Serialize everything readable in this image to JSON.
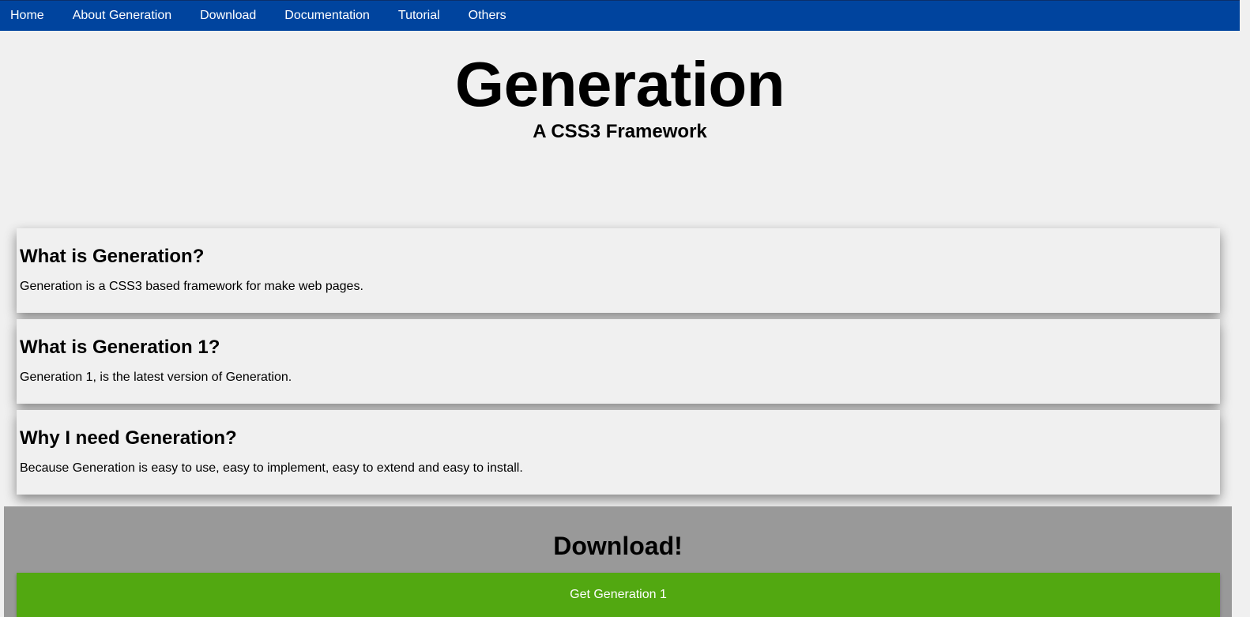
{
  "nav": {
    "items": [
      {
        "label": "Home"
      },
      {
        "label": "About Generation"
      },
      {
        "label": "Download"
      },
      {
        "label": "Documentation"
      },
      {
        "label": "Tutorial"
      },
      {
        "label": "Others"
      }
    ]
  },
  "hero": {
    "title": "Generation",
    "subtitle": "A CSS3 Framework"
  },
  "cards": [
    {
      "title": "What is Generation?",
      "text": "Generation is a CSS3 based framework for make web pages."
    },
    {
      "title": "What is Generation 1?",
      "text": "Generation 1, is the latest version of Generation."
    },
    {
      "title": "Why I need Generation?",
      "text": "Because Generation is easy to use, easy to implement, easy to extend and easy to install."
    }
  ],
  "download": {
    "title": "Download!",
    "button_label": "Get Generation 1"
  },
  "colors": {
    "nav_bg": "#00449e",
    "page_bg": "#f0f0f0",
    "download_bg": "#999999",
    "button_bg": "#52a811"
  }
}
